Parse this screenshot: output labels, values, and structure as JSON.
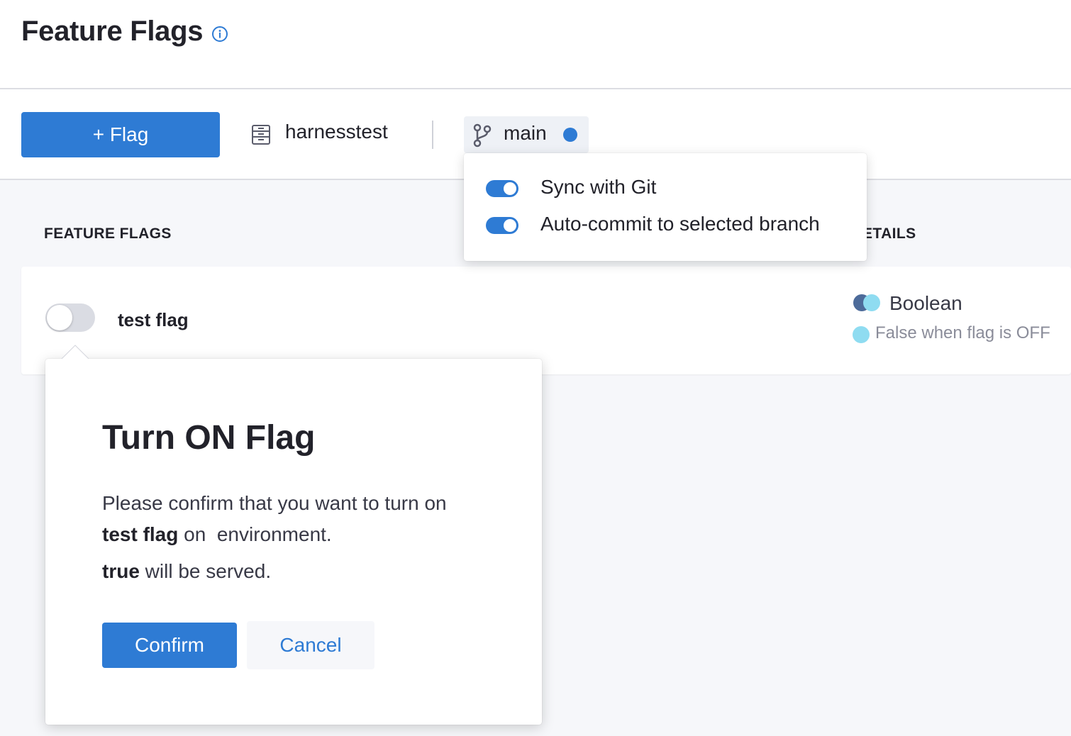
{
  "header": {
    "title": "Feature Flags",
    "info_icon": "info-icon"
  },
  "toolbar": {
    "add_flag_label": "+ Flag",
    "repo_icon": "repository-icon",
    "repo_name": "harnesstest",
    "branch_icon": "git-branch-icon",
    "branch_name": "main",
    "branch_status_color": "#2e7bd4"
  },
  "git_dropdown": {
    "options": [
      {
        "label": "Sync with Git",
        "enabled": true
      },
      {
        "label": "Auto-commit to selected branch",
        "enabled": true
      }
    ]
  },
  "list": {
    "column_flags": "FEATURE FLAGS",
    "column_details": "ETAILS",
    "rows": [
      {
        "name": "test flag",
        "enabled": false,
        "type": "Boolean",
        "default_off": "False when flag is OFF"
      }
    ]
  },
  "confirm_popover": {
    "title": "Turn ON Flag",
    "body_prefix": "Please confirm that you want to turn on",
    "flag_name": "test flag",
    "body_suffix": " on  environment.",
    "serve_value": "true",
    "serve_suffix": " will be served.",
    "confirm_label": "Confirm",
    "cancel_label": "Cancel"
  },
  "colors": {
    "accent": "#2e7bd4",
    "toggle_off": "#dadce3",
    "boolean_dark": "#4d6b9a",
    "boolean_light": "#8fdcf1"
  }
}
